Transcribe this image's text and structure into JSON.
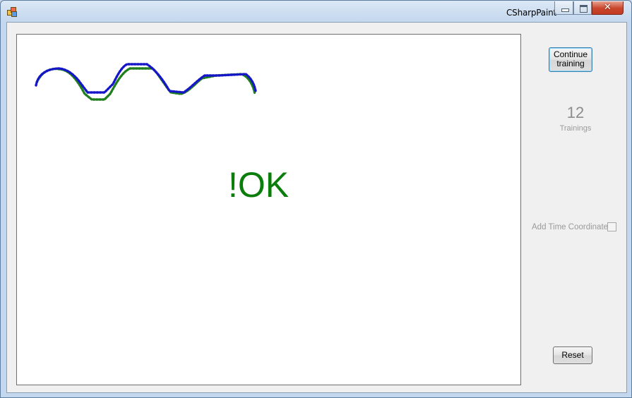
{
  "window": {
    "title": "CSharpPaint",
    "close_glyph": "✕"
  },
  "canvas": {
    "result_text": "!OK",
    "template_stroke_color": "#1f7f1f",
    "input_stroke_color": "#1616c8"
  },
  "sidebar": {
    "continue_label": "Continue training",
    "training_count": "12",
    "training_label": "Trainings",
    "time_coord_label": "Add Time Coordinate",
    "time_coord_checked": false,
    "reset_label": "Reset"
  }
}
